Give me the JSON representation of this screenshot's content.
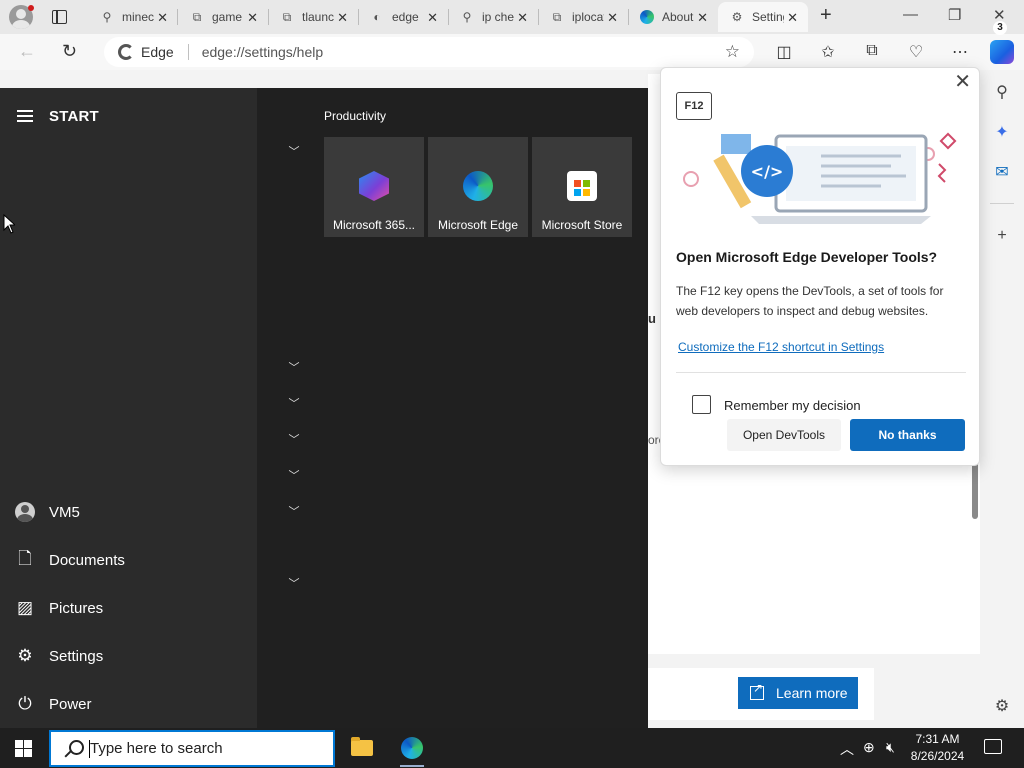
{
  "browser": {
    "tabs": [
      {
        "label": "minecraft",
        "icon": "search-icon"
      },
      {
        "label": "game",
        "icon": "tab-page-icon"
      },
      {
        "label": "tlauncher",
        "icon": "tab-page-icon"
      },
      {
        "label": "edge",
        "icon": "tab-page-icon"
      },
      {
        "label": "ip check",
        "icon": "search-icon"
      },
      {
        "label": "iplocation",
        "icon": "tab-page-icon"
      },
      {
        "label": "About",
        "icon": "edge-icon"
      },
      {
        "label": "Settings",
        "icon": "gear-icon",
        "active": true
      }
    ],
    "omnibox": {
      "label": "Edge",
      "url": "edge://settings/help"
    }
  },
  "page": {
    "fragment_u": "u",
    "fragment_orc": "orc",
    "learn_more": "Learn more"
  },
  "start_menu": {
    "title": "START",
    "group_title": "Productivity",
    "tiles": [
      {
        "label": "Microsoft 365...",
        "icon": "microsoft-365-icon"
      },
      {
        "label": "Microsoft Edge",
        "icon": "edge-icon"
      },
      {
        "label": "Microsoft Store",
        "icon": "store-icon"
      }
    ],
    "items": [
      {
        "label": "VM5",
        "icon": "user-avatar-icon"
      },
      {
        "label": "Documents",
        "icon": "document-icon"
      },
      {
        "label": "Pictures",
        "icon": "pictures-icon"
      },
      {
        "label": "Settings",
        "icon": "gear-icon"
      },
      {
        "label": "Power",
        "icon": "power-icon"
      }
    ]
  },
  "dialog": {
    "key_label": "F12",
    "title": "Open Microsoft Edge Developer Tools?",
    "body": "The F12 key opens the DevTools, a set of tools for web developers to inspect and debug websites.",
    "link": "Customize the F12 shortcut in Settings",
    "checkbox_label": "Remember my decision",
    "checkbox_checked": false,
    "secondary_button": "Open DevTools",
    "primary_button": "No thanks"
  },
  "taskbar": {
    "search_placeholder": "Type here to search",
    "time": "7:31 AM",
    "date": "8/26/2024",
    "notification_count": "3"
  },
  "colors": {
    "accent": "#0f6cbd",
    "start_menu_bg": "#202020",
    "start_column_bg": "#2b2b2b",
    "tile_bg": "#3a3a3a",
    "taskbar_bg": "#1f1f1f"
  }
}
